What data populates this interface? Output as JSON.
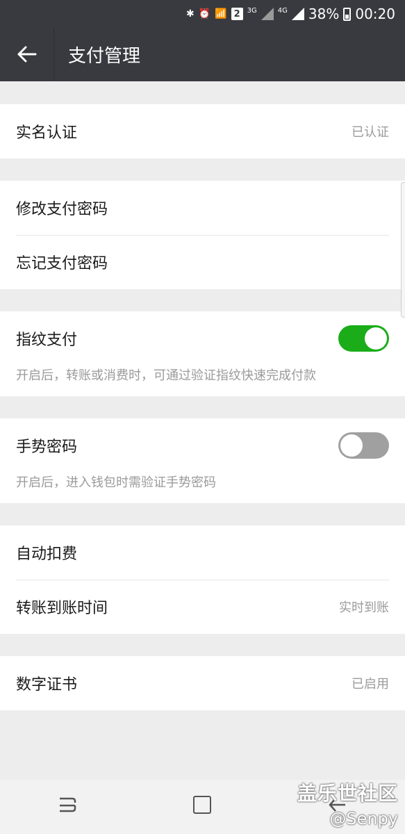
{
  "status_bar": {
    "bluetooth_icon": "bluetooth-icon",
    "alarm_icon": "alarm-icon",
    "wifi_icon": "wifi-icon",
    "sim_badge": "2",
    "net1": "3G",
    "net2": "4G",
    "battery": "38%",
    "time": "00:20"
  },
  "header": {
    "back_icon": "back-arrow-icon",
    "title": "支付管理"
  },
  "groups": {
    "identity": {
      "label": "实名认证",
      "value": "已认证"
    },
    "password": {
      "change": "修改支付密码",
      "forgot": "忘记支付密码"
    },
    "fingerprint": {
      "label": "指纹支付",
      "desc": "开启后，转账或消费时，可通过验证指纹快速完成付款",
      "enabled": true
    },
    "gesture": {
      "label": "手势密码",
      "desc": "开启后，进入钱包时需验证手势密码",
      "enabled": false
    },
    "deduction": {
      "auto": "自动扣费",
      "transfer": "转账到账时间",
      "transfer_value": "实时到账"
    },
    "certificate": {
      "label": "数字证书",
      "value": "已启用"
    }
  },
  "colors": {
    "accent": "#1aad19",
    "header_bg": "#393a3f",
    "toggle_off": "#a0a0a0"
  },
  "watermark": {
    "line1": "盖乐世社区",
    "line2": "@Senpy"
  }
}
